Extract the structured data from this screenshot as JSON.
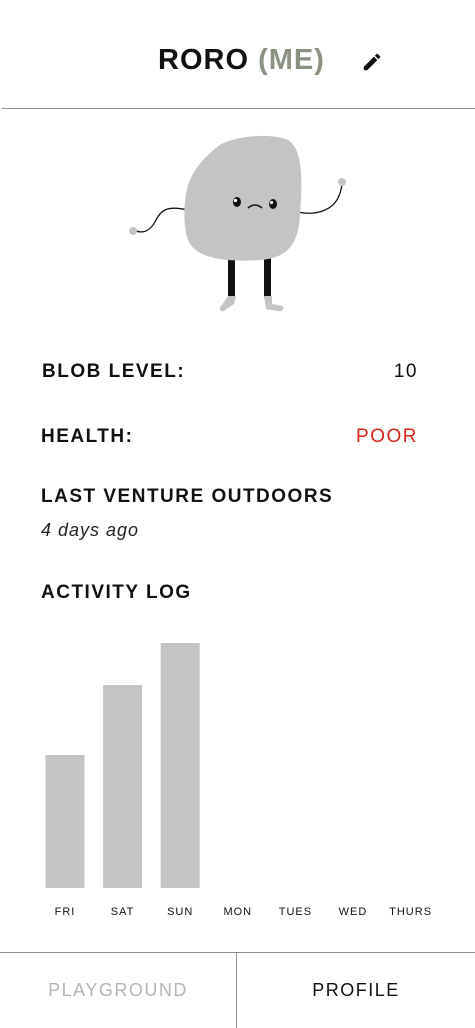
{
  "header": {
    "name": "RORO",
    "me_tag": "(ME)",
    "edit_icon": "pencil-icon"
  },
  "stats": {
    "blob_level_label": "BLOB LEVEL:",
    "blob_level_value": "10",
    "health_label": "HEALTH:",
    "health_value": "POOR",
    "health_color": "#d9261c",
    "last_outdoors_label": "LAST VENTURE OUTDOORS",
    "last_outdoors_value": "4 days ago"
  },
  "activity": {
    "title": "ACTIVITY LOG"
  },
  "chart_data": {
    "type": "bar",
    "categories": [
      "FRI",
      "SAT",
      "SUN",
      "MON",
      "TUES",
      "WED",
      "THURS"
    ],
    "values": [
      133,
      203,
      245,
      0,
      0,
      0,
      0
    ],
    "ylim": [
      0,
      260
    ],
    "bar_color": "#c4c4c4",
    "grid": false
  },
  "tabs": [
    {
      "label": "PLAYGROUND",
      "active": false
    },
    {
      "label": "PROFILE",
      "active": true
    }
  ],
  "colors": {
    "me_tag": "#8a9281",
    "inactive_tab": "#b5b5b5",
    "divider": "#8f8f8f"
  }
}
